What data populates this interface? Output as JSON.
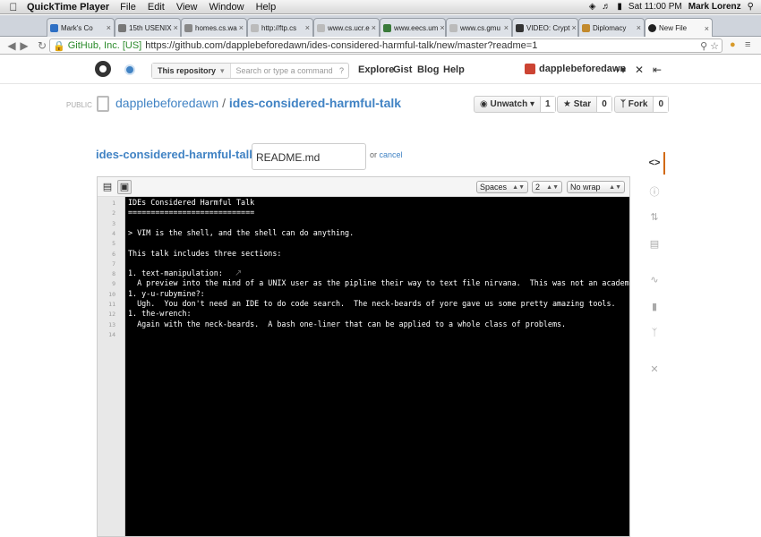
{
  "menubar": {
    "app": "QuickTime Player",
    "menus": [
      "File",
      "Edit",
      "View",
      "Window",
      "Help"
    ],
    "clock": "Sat 11:00 PM",
    "user": "Mark Lorenz"
  },
  "tabs": [
    {
      "label": "Mark's Co",
      "color": "#2e6fc4"
    },
    {
      "label": "15th USENIX",
      "color": "#777777"
    },
    {
      "label": "homes.cs.wa",
      "color": "#888888"
    },
    {
      "label": "http://ftp.cs",
      "color": "#bbbbbb"
    },
    {
      "label": "www.cs.ucr.e",
      "color": "#bbbbbb"
    },
    {
      "label": "www.eecs.um",
      "color": "#3a7a3a"
    },
    {
      "label": "www.cs.gmu",
      "color": "#bbbbbb"
    },
    {
      "label": "VIDEO: Crypt",
      "color": "#333333"
    },
    {
      "label": "Diplomacy",
      "color": "#c28a2e"
    },
    {
      "label": "New File",
      "color": "#222222"
    }
  ],
  "address": {
    "ev_label": "GitHub, Inc. [US]",
    "url": "https://github.com/dapplebeforedawn/ides-considered-harmful-talk/new/master?readme=1"
  },
  "header": {
    "search_scope": "This repository",
    "search_placeholder": "Search or type a command",
    "nav": [
      "Explore",
      "Gist",
      "Blog",
      "Help"
    ],
    "username": "dapplebeforedawn"
  },
  "repo": {
    "visibility": "PUBLIC",
    "owner": "dapplebeforedawn",
    "name": "ides-considered-harmful-talk",
    "unwatch_label": "Unwatch",
    "unwatch_count": "1",
    "star_label": "Star",
    "star_count": "0",
    "fork_label": "Fork",
    "fork_count": "0"
  },
  "editor": {
    "crumb_repo": "ides-considered-harmful-talk",
    "filename": "README.md",
    "or_text": "or",
    "cancel_label": "cancel",
    "indent_mode": "Spaces",
    "indent_size": "2",
    "wrap_mode": "No wrap",
    "lines": [
      "IDEs Considered Harmful Talk",
      "============================",
      "",
      "> VIM is the shell, and the shell can do anything.",
      "",
      "This talk includes three sections:",
      "",
      "1. text-manipulation:",
      "  A preview into the mind of a UNIX user as the pipline their way to text file nirvana.  This was not an academic excer",
      "1. y-u-rubymine?:",
      "  Ugh.  You don't need an IDE to do code search.  The neck-beards of yore gave us some pretty amazing tools.",
      "1. the-wrench:",
      "  Again with the neck-beards.  A bash one-liner that can be applied to a whole class of problems.",
      ""
    ]
  },
  "right_nav_icons": [
    "code-icon",
    "issues-icon",
    "pull-request-icon",
    "wiki-icon",
    "pulse-icon",
    "graphs-icon",
    "network-icon",
    "settings-icon"
  ]
}
